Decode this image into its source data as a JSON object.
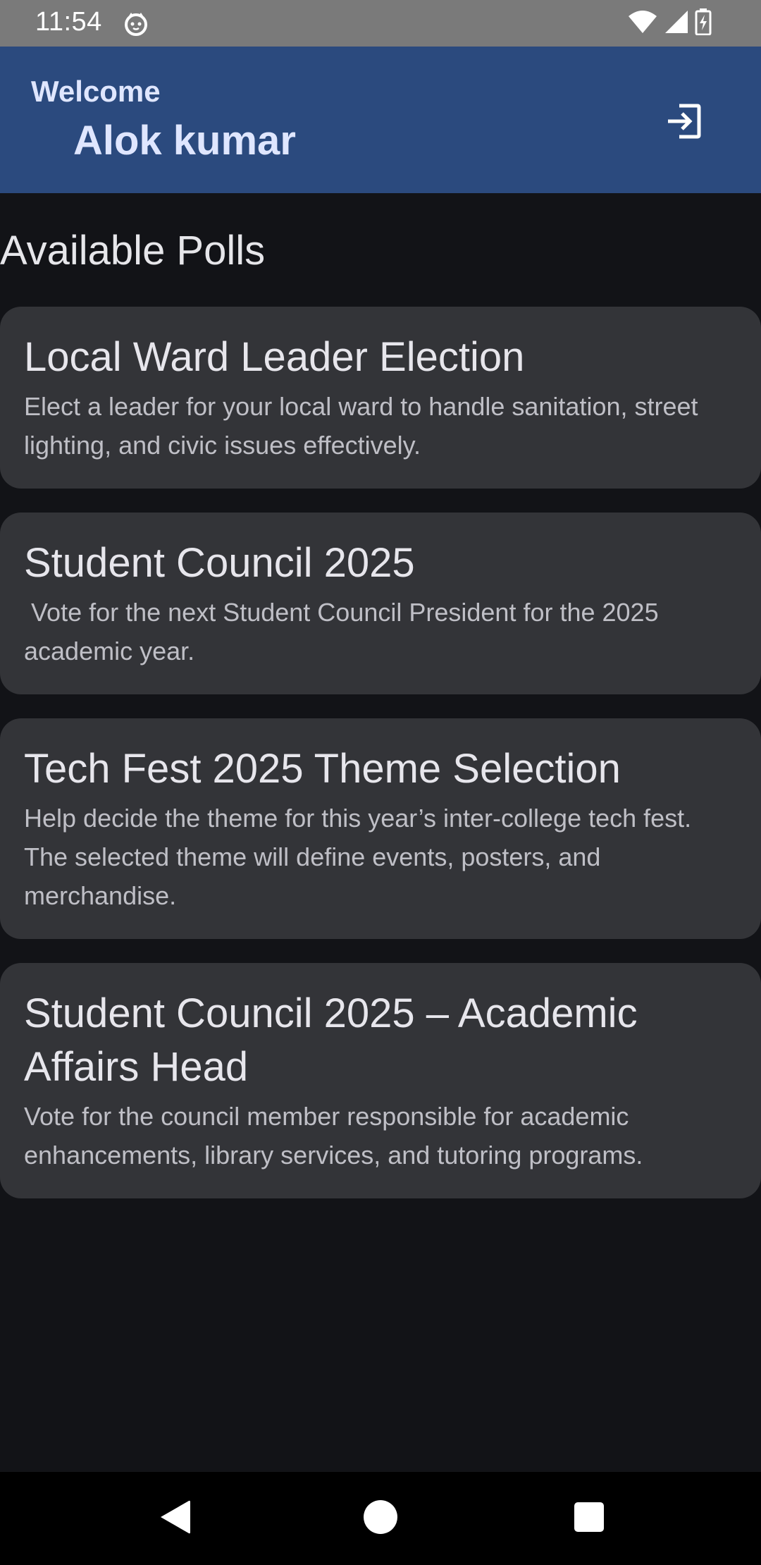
{
  "status_bar": {
    "time": "11:54",
    "app_icon": "cat-face-icon",
    "wifi_icon": "wifi-icon",
    "signal_icon": "cell-signal-icon",
    "battery_icon": "battery-charging-icon"
  },
  "header": {
    "welcome": "Welcome",
    "user_name": "Alok kumar",
    "logout_icon": "logout-icon",
    "background_color": "#2b4a7e"
  },
  "main": {
    "section_title": "Available Polls",
    "polls": [
      {
        "title": "Local Ward Leader Election",
        "description": "Elect a leader for your local ward to handle sanitation, street lighting, and civic issues effectively."
      },
      {
        "title": "Student Council 2025",
        "description": " Vote for the next Student Council President for the 2025 academic year."
      },
      {
        "title": "Tech Fest 2025 Theme Selection",
        "description": "Help decide the theme for this year’s inter-college tech fest. The selected theme will define events, posters, and merchandise."
      },
      {
        "title": "Student Council 2025 – Academic Affairs Head",
        "description": "Vote for the council member responsible for academic enhancements, library services, and tutoring programs."
      }
    ]
  },
  "nav_bar": {
    "back_icon": "back-triangle-icon",
    "home_icon": "home-circle-icon",
    "recents_icon": "recents-square-icon"
  },
  "colors": {
    "background": "#121317",
    "card": "#333438",
    "header": "#2b4a7e",
    "status_bar": "#7a7a7a"
  }
}
